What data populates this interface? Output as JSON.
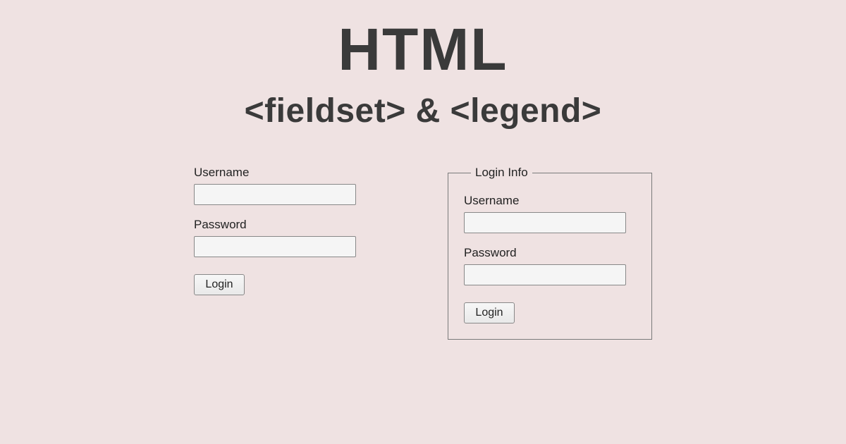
{
  "heading": {
    "title": "HTML",
    "subtitle": "<fieldset> & <legend>"
  },
  "forms": {
    "plain": {
      "username_label": "Username",
      "password_label": "Password",
      "login_button": "Login"
    },
    "grouped": {
      "legend": "Login Info",
      "username_label": "Username",
      "password_label": "Password",
      "login_button": "Login"
    }
  }
}
